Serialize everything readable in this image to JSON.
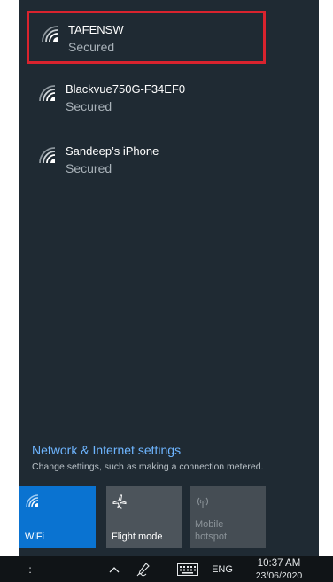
{
  "networks": [
    {
      "name": "TAFENSW",
      "status": "Secured",
      "selected": true
    },
    {
      "name": "Blackvue750G-F34EF0",
      "status": "Secured",
      "selected": false
    },
    {
      "name": "Sandeep’s iPhone",
      "status": "Secured",
      "selected": false
    }
  ],
  "settings": {
    "link": "Network & Internet settings",
    "description": "Change settings, such as making a connection metered."
  },
  "quick_actions": [
    {
      "label": "WiFi",
      "icon": "wifi-icon",
      "active": true
    },
    {
      "label": "Flight mode",
      "icon": "airplane-icon",
      "active": false
    },
    {
      "label": "Mobile\nhotspot",
      "icon": "hotspot-icon",
      "active": false,
      "disabled": true
    }
  ],
  "taskbar": {
    "overflow_glyph": ":",
    "language": "ENG",
    "time": "10:37 AM",
    "date": "23/06/2020"
  },
  "colors": {
    "flyout_bg": "#1f2a33",
    "accent": "#0a73d1",
    "link": "#6eb5ff",
    "highlight_box": "#d9232e"
  }
}
